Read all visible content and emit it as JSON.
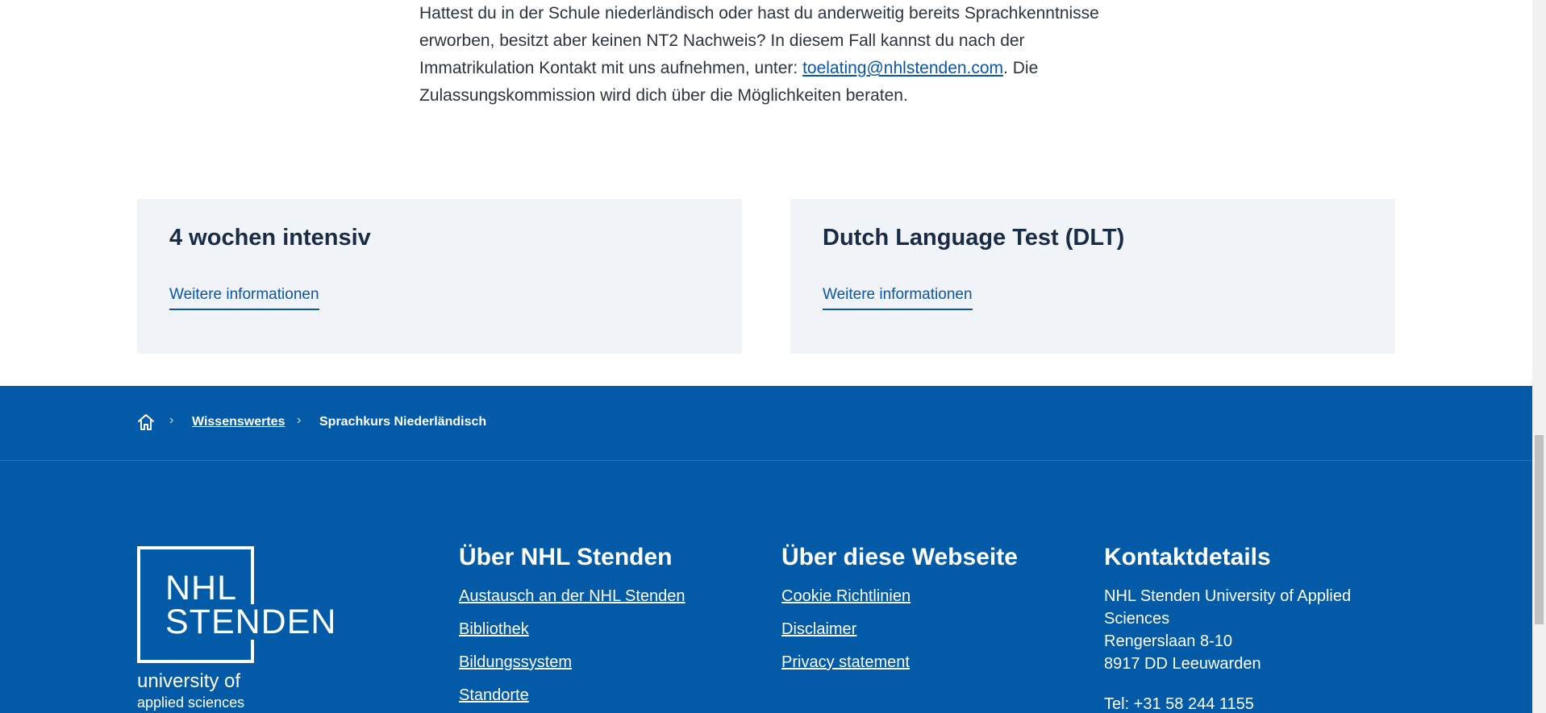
{
  "intro": {
    "text_before": "Hattest du in der Schule niederländisch oder hast du anderweitig bereits Sprachkenntnisse erworben, besitzt aber keinen NT2 Nachweis? In diesem Fall kannst du nach der Immatrikulation Kontakt mit uns aufnehmen, unter: ",
    "email": "toelating@nhlstenden.com",
    "text_after": ". Die Zulassungskommission wird dich über die Möglichkeiten beraten."
  },
  "cards": [
    {
      "title": "4 wochen intensiv",
      "link": "Weitere informationen"
    },
    {
      "title": "Dutch Language Test (DLT)",
      "link": "Weitere informationen"
    }
  ],
  "breadcrumb": {
    "items": [
      "Wissenswertes",
      "Sprachkurs Niederländisch"
    ],
    "separator": "›",
    "home_icon": "home-icon"
  },
  "logo": {
    "line1": "NHL",
    "line2": "STENDEN",
    "line3": "university of",
    "line4": "applied sciences"
  },
  "footer": {
    "about": {
      "title": "Über NHL Stenden",
      "links": [
        "Austausch an der NHL Stenden",
        "Bibliothek",
        "Bildungssystem",
        "Standorte"
      ]
    },
    "site": {
      "title": "Über diese Webseite",
      "links": [
        "Cookie Richtlinien",
        "Disclaimer",
        "Privacy statement"
      ]
    },
    "contact": {
      "title": "Kontaktdetails",
      "lines": [
        "NHL Stenden University of Applied Sciences",
        "Rengerslaan 8-10",
        "8917 DD Leeuwarden"
      ],
      "tel": "Tel: +31 58 244 1155"
    }
  },
  "colors": {
    "footer_bg": "#035aa6",
    "card_bg": "#f0f4f9",
    "link": "#0b55a8"
  }
}
